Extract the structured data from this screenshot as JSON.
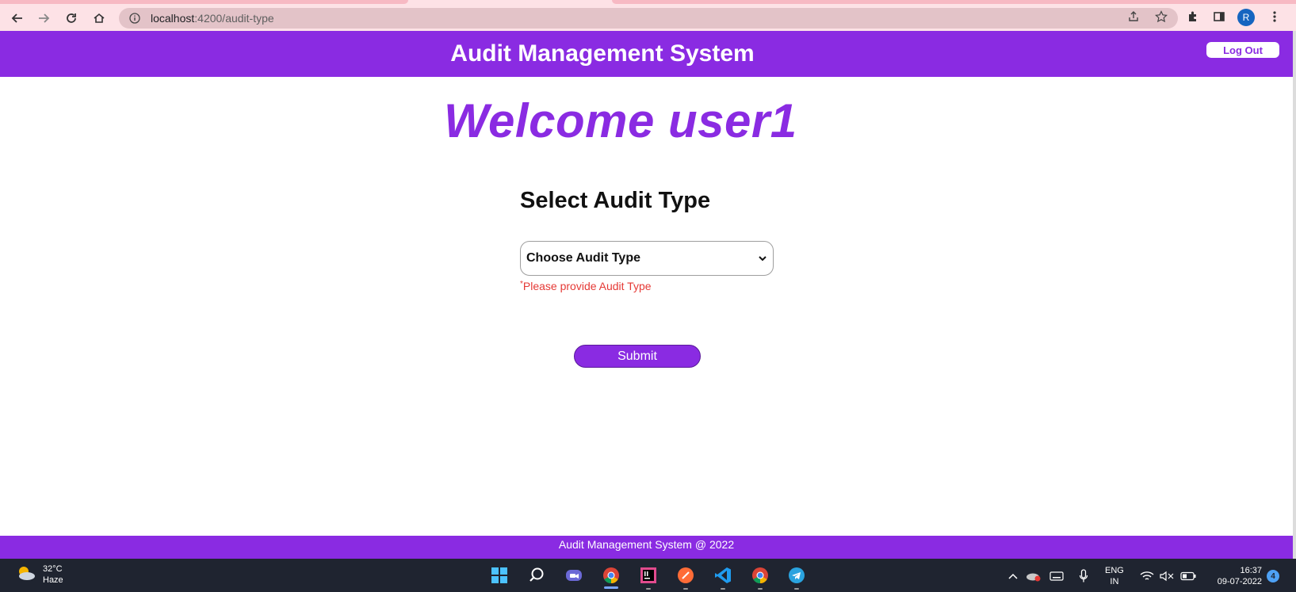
{
  "browser": {
    "url_host": "localhost",
    "url_rest": ":4200/audit-type",
    "profile_initial": "R"
  },
  "header": {
    "title": "Audit Management System",
    "logout_label": "Log Out"
  },
  "main": {
    "welcome": "Welcome user1",
    "section_title": "Select Audit Type",
    "select_value": "Choose Audit Type",
    "error_star": "*",
    "error_text": "Please provide Audit Type",
    "submit_label": "Submit"
  },
  "footer": {
    "text": "Audit Management System @ 2022"
  },
  "taskbar": {
    "temperature": "32°C",
    "weather": "Haze",
    "lang_top": "ENG",
    "lang_bottom": "IN",
    "time": "16:37",
    "date": "09-07-2022",
    "notifications": "4"
  },
  "colors": {
    "brand": "#8a2be2",
    "error": "#e53935"
  },
  "icons": [
    "back-icon",
    "forward-icon",
    "reload-icon",
    "home-icon",
    "info-icon",
    "share-icon",
    "star-icon",
    "extensions-icon",
    "sidepanel-icon",
    "menu-icon",
    "chevron-down-icon"
  ]
}
